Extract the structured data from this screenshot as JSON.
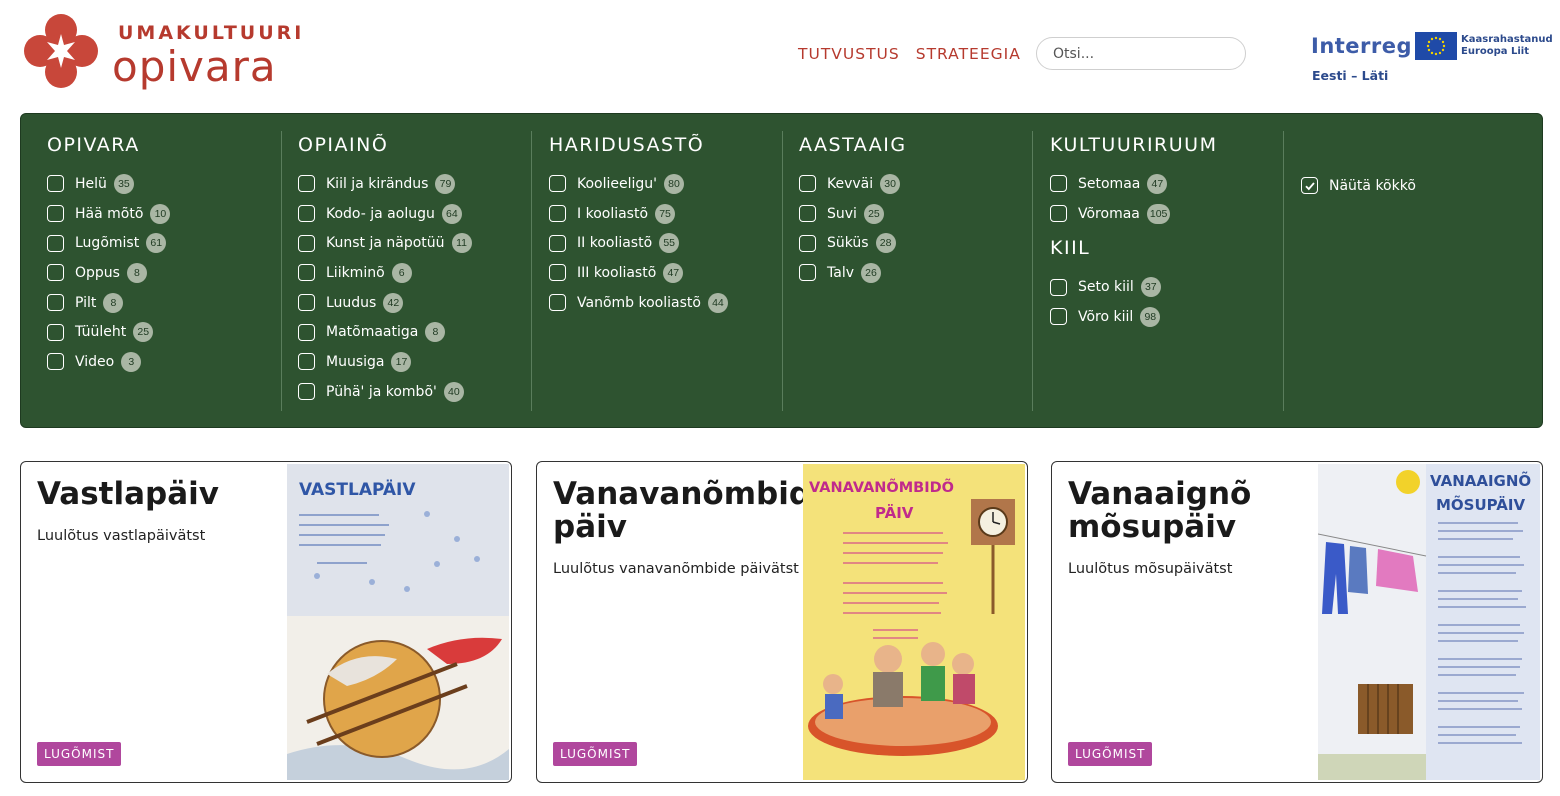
{
  "logo": {
    "top": "UMAKULTUURI",
    "main": "opivara"
  },
  "nav": [
    {
      "label": "TUTVUSTUS"
    },
    {
      "label": "STRATEEGIA"
    }
  ],
  "search": {
    "placeholder": "Otsi..."
  },
  "sponsor": {
    "interreg": "Interreg",
    "region": "Eesti – Läti",
    "eu_line1": "Kaasrahastanud",
    "eu_line2": "Euroopa Liit"
  },
  "filters": [
    {
      "heading": "OPIVARA",
      "items": [
        {
          "label": "Helü",
          "count": "35"
        },
        {
          "label": "Hää mõtõ",
          "count": "10"
        },
        {
          "label": "Lugõmist",
          "count": "61"
        },
        {
          "label": "Oppus",
          "count": "8"
        },
        {
          "label": "Pilt",
          "count": "8"
        },
        {
          "label": "Tüüleht",
          "count": "25"
        },
        {
          "label": "Video",
          "count": "3"
        }
      ]
    },
    {
      "heading": "OPIAINÕ",
      "items": [
        {
          "label": "Kiil ja kirändus",
          "count": "79"
        },
        {
          "label": "Kodo- ja aolugu",
          "count": "64"
        },
        {
          "label": "Kunst ja näpotüü",
          "count": "11"
        },
        {
          "label": "Liikminõ",
          "count": "6"
        },
        {
          "label": "Luudus",
          "count": "42"
        },
        {
          "label": "Matõmaatiga",
          "count": "8"
        },
        {
          "label": "Muusiga",
          "count": "17"
        },
        {
          "label": "Pühä' ja kombõ'",
          "count": "40"
        }
      ]
    },
    {
      "heading": "HARIDUSASTÕ",
      "items": [
        {
          "label": "Koolieeligu'",
          "count": "80"
        },
        {
          "label": "I kooliastõ",
          "count": "75"
        },
        {
          "label": "II kooliastõ",
          "count": "55"
        },
        {
          "label": "III kooliastõ",
          "count": "47"
        },
        {
          "label": "Vanõmb kooliastõ",
          "count": "44"
        }
      ]
    },
    {
      "heading": "AASTAAIG",
      "items": [
        {
          "label": "Kevväi",
          "count": "30"
        },
        {
          "label": "Suvi",
          "count": "25"
        },
        {
          "label": "Süküs",
          "count": "28"
        },
        {
          "label": "Talv",
          "count": "26"
        }
      ]
    },
    {
      "heading": "KULTUURIRUUM",
      "items": [
        {
          "label": "Setomaa",
          "count": "47"
        },
        {
          "label": "Võromaa",
          "count": "105"
        }
      ]
    },
    {
      "heading": "KIIL",
      "items": [
        {
          "label": "Seto kiil",
          "count": "37"
        },
        {
          "label": "Võro kiil",
          "count": "98"
        }
      ]
    }
  ],
  "show_all": {
    "label": "Näütä kõkkõ",
    "checked": true
  },
  "cards": [
    {
      "title": "Vastlapäiv",
      "subtitle": "Luulõtus vastlapäivätst",
      "tag": "LUGÕMIST",
      "poster_title": "VASTLAPÄIV"
    },
    {
      "title": "Vanavanõmbide päiv",
      "subtitle": "Luulõtus vanavanõmbide päivätst",
      "tag": "LUGÕMIST",
      "poster_title_1": "VANAVANÕMBIDÕ",
      "poster_title_2": "PÄIV"
    },
    {
      "title": "Vanaaignõ mõsupäiv",
      "subtitle": "Luulõtus mõsupäivätst",
      "tag": "LUGÕMIST",
      "poster_title_1": "VANAAIGNÕ",
      "poster_title_2": "MÕSUPÄIV"
    }
  ],
  "colors": {
    "brand_red": "#b63a2e",
    "panel_green": "#2e5330",
    "tag_purple": "#b0479d"
  }
}
